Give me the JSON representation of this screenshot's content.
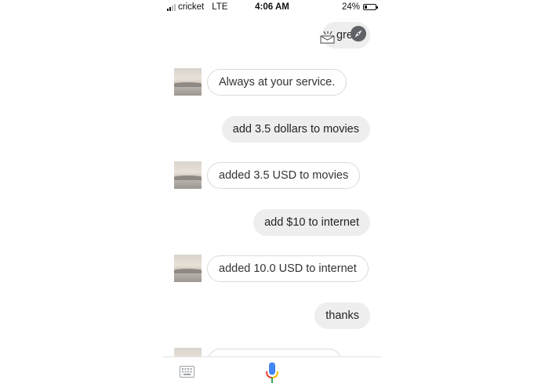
{
  "status_bar": {
    "carrier": "cricket",
    "network": "LTE",
    "time": "4:06 AM",
    "battery_percent": "24%",
    "battery_level": 0.24,
    "signal_bars_filled": 2,
    "signal_bars_total": 4
  },
  "messages": [
    {
      "role": "user",
      "text": "grea",
      "partially_visible": true
    },
    {
      "role": "assistant",
      "text": "Always at your service."
    },
    {
      "role": "user",
      "text": "add 3.5 dollars to movies"
    },
    {
      "role": "assistant",
      "text": "added 3.5 USD to movies"
    },
    {
      "role": "user",
      "text": "add $10 to internet"
    },
    {
      "role": "assistant",
      "text": "added 10.0 USD to internet"
    },
    {
      "role": "user",
      "text": "thanks"
    },
    {
      "role": "assistant",
      "text": "",
      "partially_visible": true
    }
  ],
  "icons": {
    "overlay": [
      "mail-icon",
      "compass-icon"
    ],
    "bottom_bar": [
      "keyboard-icon",
      "microphone-icon"
    ]
  },
  "colors": {
    "user_bubble": "#eeeeee",
    "assistant_bubble_border": "#dadada",
    "mic_blue": "#4285F4",
    "mic_red": "#EA4335",
    "mic_yellow": "#FBBC05",
    "mic_green": "#34A853"
  }
}
